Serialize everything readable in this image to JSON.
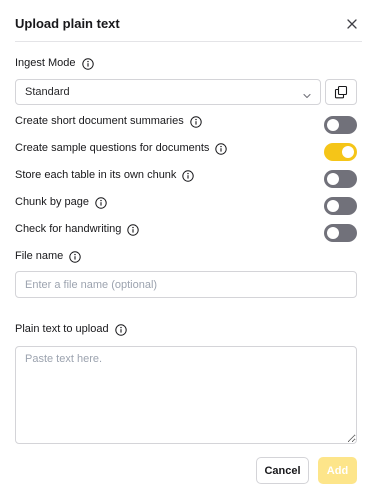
{
  "dialog": {
    "title": "Upload plain text"
  },
  "ingest_mode": {
    "label": "Ingest Mode",
    "selected": "Standard"
  },
  "options": [
    {
      "label": "Create short document summaries",
      "enabled": false
    },
    {
      "label": "Create sample questions for documents",
      "enabled": true
    },
    {
      "label": "Store each table in its own chunk",
      "enabled": false
    },
    {
      "label": "Chunk by page",
      "enabled": false
    },
    {
      "label": "Check for handwriting",
      "enabled": false
    }
  ],
  "file_name": {
    "label": "File name",
    "placeholder": "Enter a file name (optional)",
    "value": ""
  },
  "plain_text": {
    "label": "Plain text to upload",
    "placeholder": "Paste text here.",
    "value": ""
  },
  "actions": {
    "cancel_label": "Cancel",
    "add_label": "Add",
    "add_enabled": false
  },
  "icons": {
    "close": "close-icon",
    "info": "info-icon",
    "chevron": "chevron-down-icon",
    "copy": "copy-icon"
  },
  "colors": {
    "toggle_on": "#f5c518",
    "toggle_off": "#71717a",
    "add_disabled": "#fde58a"
  }
}
